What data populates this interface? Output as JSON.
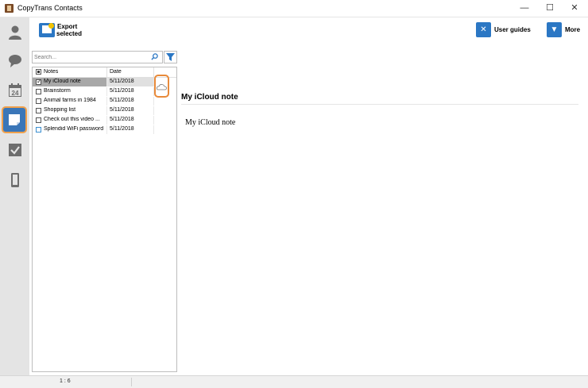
{
  "window": {
    "title": "CopyTrans Contacts",
    "controls": [
      "minimize",
      "maximize",
      "close"
    ]
  },
  "sidebar": {
    "items": [
      {
        "name": "contacts",
        "icon": "person-icon"
      },
      {
        "name": "messages",
        "icon": "chat-bubble-icon"
      },
      {
        "name": "calendars",
        "icon": "calendar-icon",
        "label": "24"
      },
      {
        "name": "notes",
        "icon": "note-icon",
        "active": true
      },
      {
        "name": "tasks",
        "icon": "checkbox-icon"
      },
      {
        "name": "device",
        "icon": "phone-icon"
      }
    ]
  },
  "toolbar": {
    "export_label_line1": "Export",
    "export_label_line2": "selected",
    "user_guides_label": "User guides",
    "more_label": "More"
  },
  "search": {
    "placeholder": "Search..."
  },
  "notes_table": {
    "header_notes": "Notes",
    "header_date": "Date",
    "rows": [
      {
        "title": "My iCloud note",
        "date": "5/11/2018",
        "checked": true,
        "selected": true,
        "cloud": true
      },
      {
        "title": "Brainstorm",
        "date": "5/11/2018",
        "checked": false
      },
      {
        "title": "Animal farms in 1984",
        "date": "5/11/2018",
        "checked": false
      },
      {
        "title": "Shopping list",
        "date": "5/11/2018",
        "checked": false
      },
      {
        "title": "Check out this video ...",
        "date": "5/11/2018",
        "checked": false
      },
      {
        "title": "Splendid WiFi password",
        "date": "5/11/2018",
        "checked": false
      }
    ]
  },
  "note_view": {
    "title": "My iCloud note",
    "body": "My iCloud note"
  },
  "status": {
    "text": "1 : 6"
  },
  "colors": {
    "accent": "#3a76b8",
    "highlight": "#e88a3a",
    "selected_row": "#a8a8a8"
  }
}
